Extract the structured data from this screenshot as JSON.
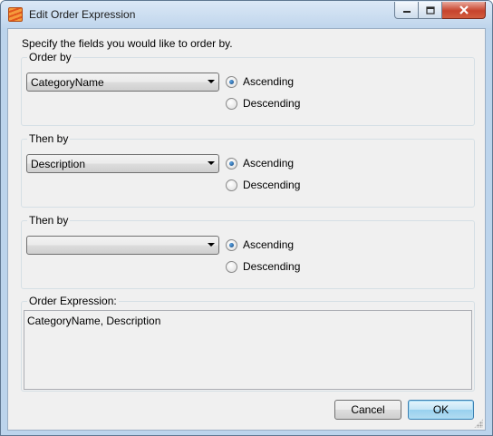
{
  "window": {
    "title": "Edit Order Expression",
    "controls": {
      "minimize_icon": "minimize-icon",
      "maximize_icon": "maximize-icon",
      "close_icon": "close-icon"
    }
  },
  "instruction": "Specify the fields you would like to order by.",
  "groups": [
    {
      "label": "Order by",
      "field": "CategoryName",
      "ascending_label": "Ascending",
      "descending_label": "Descending",
      "selected": "Ascending"
    },
    {
      "label": "Then by",
      "field": "Description",
      "ascending_label": "Ascending",
      "descending_label": "Descending",
      "selected": "Ascending"
    },
    {
      "label": "Then by",
      "field": "",
      "ascending_label": "Ascending",
      "descending_label": "Descending",
      "selected": "Ascending"
    }
  ],
  "expression": {
    "label": "Order Expression:",
    "value": "CategoryName, Description"
  },
  "buttons": {
    "cancel": "Cancel",
    "ok": "OK"
  },
  "colors": {
    "title_bar": "#bfd5ec",
    "close_button": "#c7432c",
    "dialog_background": "#f0f0f0",
    "default_button": "#98d1ef"
  }
}
